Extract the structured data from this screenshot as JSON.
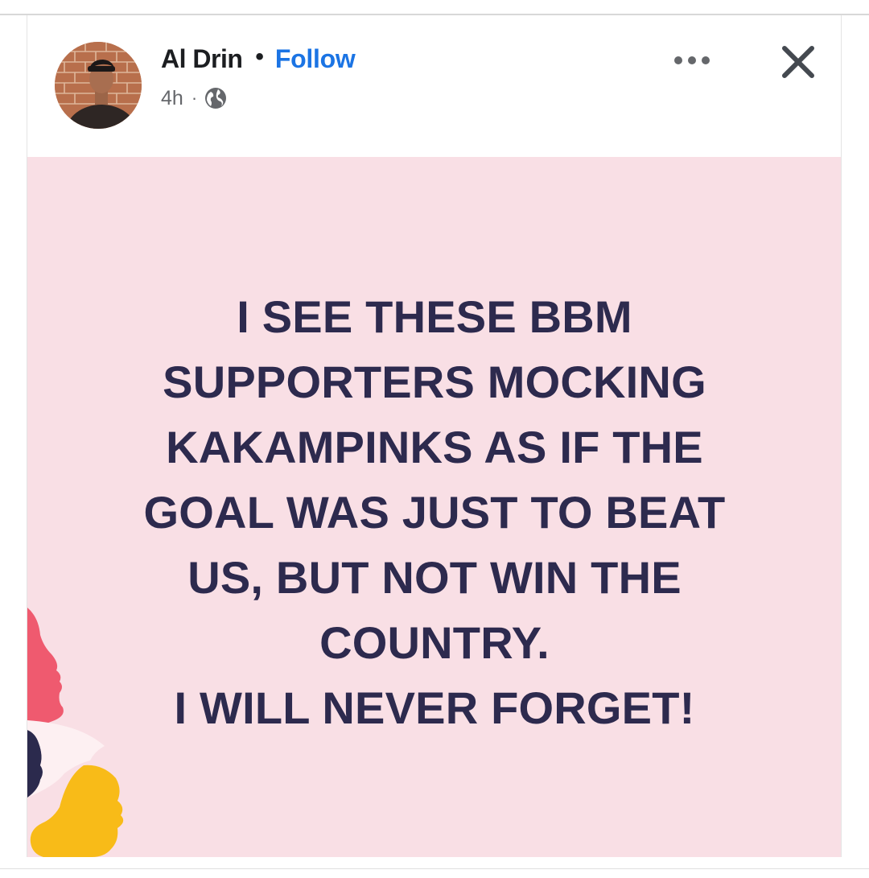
{
  "post": {
    "author_name": "Al Drin",
    "separator": "•",
    "follow_label": "Follow",
    "timestamp": "4h",
    "meta_separator": "·",
    "privacy_icon": "globe-icon",
    "more_icon": "more-options-icon",
    "close_icon": "close-icon",
    "body_text": "I SEE THESE BBM\nSUPPORTERS MOCKING\nKAKAMPINKS AS IF THE\nGOAL WAS JUST TO BEAT\nUS, BUT NOT WIN THE\nCOUNTRY.\nI WILL NEVER FORGET!"
  },
  "colors": {
    "post_background": "#f9dfe5",
    "post_text": "#2d2a4e",
    "follow_link": "#1b74e4",
    "author_text": "#1c1e21",
    "meta_text": "#65676b",
    "deco_pink": "#ef5a6f",
    "deco_navy": "#2b2a4d",
    "deco_yellow": "#f8bb18"
  }
}
